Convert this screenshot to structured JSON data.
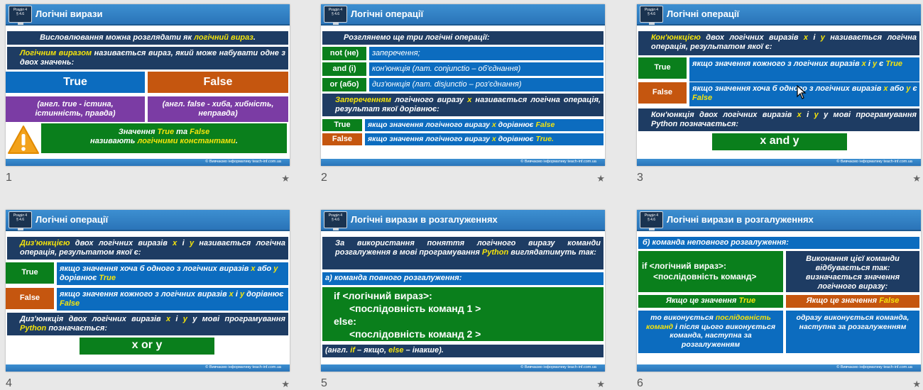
{
  "footer": "© Вивчаємо інформатику  teach-inf.com.ua",
  "badge": [
    "Розділ 4",
    "§ 4.6"
  ],
  "slides": {
    "s1": {
      "num": "1",
      "title": "Логічні вирази",
      "intro_a": "Висловлювання можна розглядати як ",
      "intro_b": "логічний вираз",
      "intro_c": ".",
      "def_a": "Логічним виразом",
      "def_b": " називається вираз, який може набувати одне з двох значень:",
      "true_label": "True",
      "false_label": "False",
      "true_desc": "(англ. true - істина, істинність, правда)",
      "false_desc": "(англ. false - хиба, хибність, неправда)",
      "note_a": "Значення ",
      "note_b": "True",
      "note_c": " та ",
      "note_d": "False",
      "note_e": "називають ",
      "note_f": "логічними константами",
      "note_g": "."
    },
    "s2": {
      "num": "2",
      "title": "Логічні операції",
      "intro": "Розглянемо ще три логічні операції:",
      "ops": [
        {
          "op": "not (не)",
          "desc": "заперечення;"
        },
        {
          "op": "and (і)",
          "desc": "кон'юнкція (лат. conjunctio – об'єднання)"
        },
        {
          "op": "or (або)",
          "desc": "диз'юнкція (лат. disjunctio – роз'єднання)"
        }
      ],
      "def_a": "Запереченням",
      "def_b": " логічного виразу ",
      "def_x": "x",
      "def_c": " називається логічна операція, результат якої дорівнює:",
      "true_label": "True",
      "false_label": "False",
      "true_a": "якщо значення логічного виразу ",
      "true_b": "x",
      "true_c": " дорівнює ",
      "true_d": "False",
      "false_a": "якщо значення логічного виразу ",
      "false_b": "x",
      "false_c": " дорівнює ",
      "false_d": "True."
    },
    "s3": {
      "num": "3",
      "title": "Логічні операції",
      "def_a": "Кон'юнкцією",
      "def_b": " двох логічних виразів ",
      "def_x": "x",
      "def_i": " і ",
      "def_y": "y",
      "def_c": " називається логічна операція, результатом якої є:",
      "true_label": "True",
      "false_label": "False",
      "true_a": "якщо значення кожного з логічних виразів ",
      "true_x": "x",
      "true_i": " і ",
      "true_y": "y",
      "true_c": " є ",
      "true_d": "True",
      "false_a": "якщо значення хоча б одного з логічних виразів ",
      "false_x": "x",
      "false_or": " або ",
      "false_y": "y",
      "false_c": " є ",
      "false_d": "False",
      "py_a": "Кон'юнкція двох логічних виразів ",
      "py_x": "x",
      "py_i": " і ",
      "py_y": "y",
      "py_b": " у мові програмування Python позначається:",
      "code": "x and y"
    },
    "s4": {
      "num": "4",
      "title": "Логічні операції",
      "def_a": "Диз'юнкцією",
      "def_b": " двох логічних виразів ",
      "def_x": "x",
      "def_i": " і ",
      "def_y": "y",
      "def_c": " називається логічна операція, результатом якої є:",
      "true_label": "True",
      "false_label": "False",
      "true_a": "якщо значення хоча б одного з логічних виразів ",
      "true_x": "x",
      "true_or": " або ",
      "true_y": "y",
      "true_c": " дорівнює ",
      "true_d": "True",
      "false_a": "якщо значення кожного з логічних виразів ",
      "false_x": "x",
      "false_i": " і ",
      "false_y": "y",
      "false_c": " дорівнює ",
      "false_d": "False",
      "py_a": "Диз'юнкція двох логічних виразів ",
      "py_x": "x",
      "py_i": " і ",
      "py_y": "y",
      "py_b": " у мові програмування ",
      "py_py": "Python",
      "py_c": " позначається:",
      "code": "x or y"
    },
    "s5": {
      "num": "5",
      "title": "Логічні вирази в розгалуженнях",
      "intro_a": "За використання поняття логічного виразу команди розгалуження в мові програмування ",
      "intro_py": "Python",
      "intro_b": " виглядатимуть так:",
      "sub": "а) команда повного розгалуження:",
      "code1": "if <логічний вираз>:",
      "code2": "<послідовність команд 1 >",
      "code3": "else:",
      "code4": "<послідовність команд 2 >",
      "note_a": "(англ. ",
      "note_if": "if",
      "note_b": " – якщо, ",
      "note_else": "else",
      "note_c": " – інакше)."
    },
    "s6": {
      "num": "6",
      "title": "Логічні вирази в розгалуженнях",
      "sub": "б) команда неповного розгалуження:",
      "code1": "if <логічний вираз>:",
      "code2": "<послідовність команд>",
      "exec": "Виконання цієї команди відбувається так: визначається значення логічного виразу:",
      "if_true_a": "Якщо це значення ",
      "if_true_b": "True",
      "if_false_a": "Якщо це значення ",
      "if_false_b": "False",
      "true_res_a": "то виконується ",
      "true_res_b": "послідовність команд",
      "true_res_c": " і після цього виконується команда, наступна за розгалуженням",
      "false_res": "одразу виконується команда, наступна за розгалуженням"
    }
  }
}
